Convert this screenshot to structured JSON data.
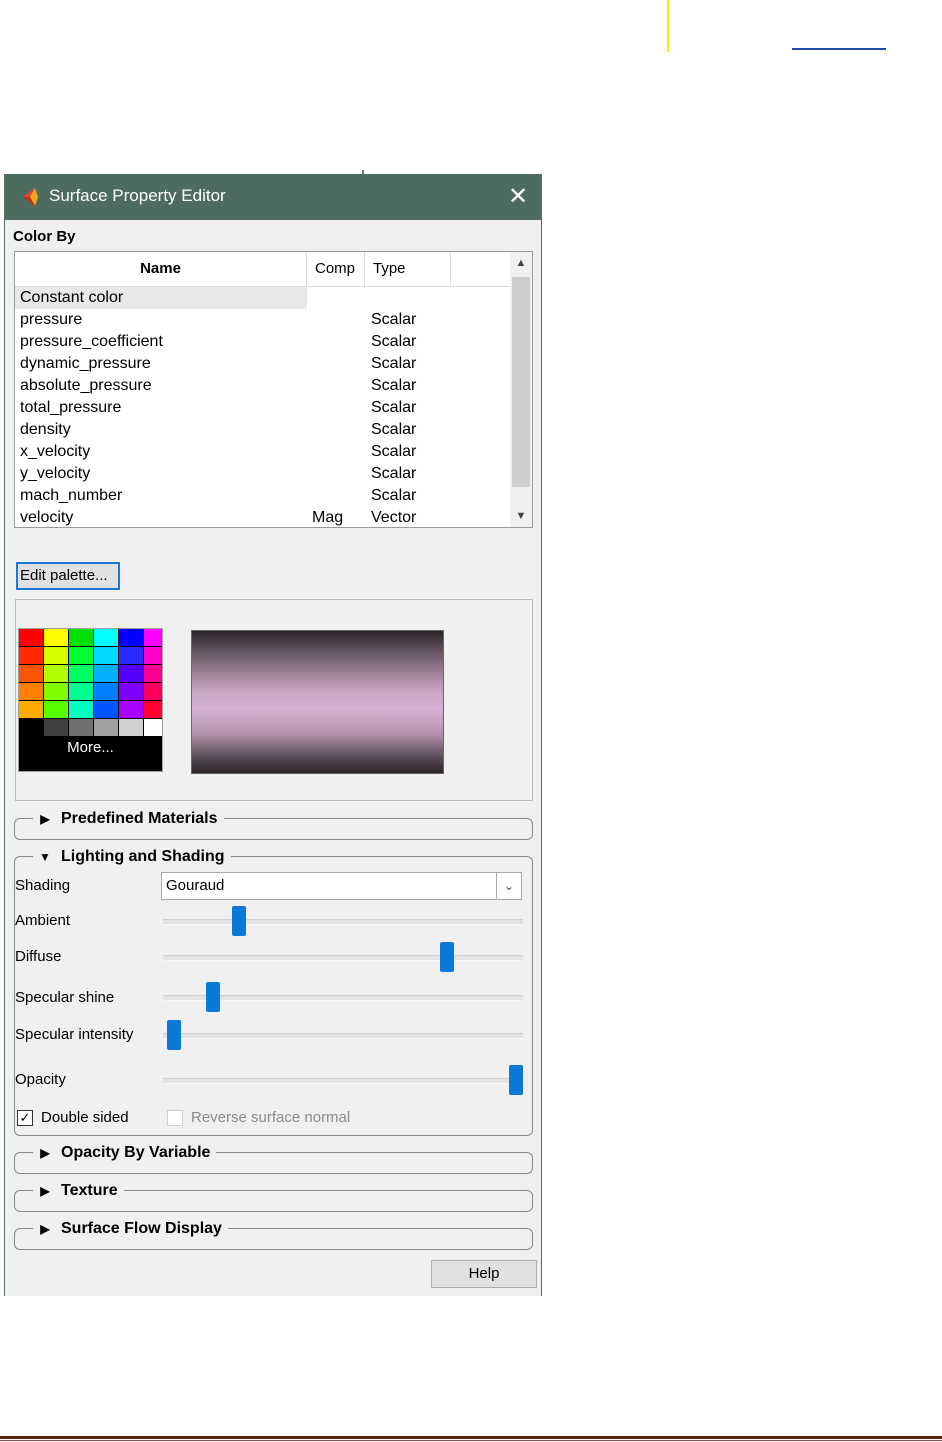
{
  "window": {
    "title": "Surface Property Editor",
    "close_label": "✕"
  },
  "color_by": {
    "label": "Color By",
    "columns": {
      "name": "Name",
      "comp": "Comp",
      "type": "Type"
    },
    "rows": [
      {
        "name": "Constant color",
        "comp": "",
        "type": ""
      },
      {
        "name": "pressure",
        "comp": "",
        "type": "Scalar"
      },
      {
        "name": "pressure_coefficient",
        "comp": "",
        "type": "Scalar"
      },
      {
        "name": "dynamic_pressure",
        "comp": "",
        "type": "Scalar"
      },
      {
        "name": "absolute_pressure",
        "comp": "",
        "type": "Scalar"
      },
      {
        "name": "total_pressure",
        "comp": "",
        "type": "Scalar"
      },
      {
        "name": "density",
        "comp": "",
        "type": "Scalar"
      },
      {
        "name": "x_velocity",
        "comp": "",
        "type": "Scalar"
      },
      {
        "name": "y_velocity",
        "comp": "",
        "type": "Scalar"
      },
      {
        "name": "mach_number",
        "comp": "",
        "type": "Scalar"
      },
      {
        "name": "velocity",
        "comp": "Mag",
        "type": "Vector"
      }
    ],
    "selected_row": "Constant color"
  },
  "palette": {
    "edit_label": "Edit palette...",
    "more_label": "More...",
    "swatch_rows": [
      [
        "#ff0000",
        "#ffff00",
        "#00e000",
        "#00ffff",
        "#0000ff",
        "#ff00ff"
      ],
      [
        "#ff2a00",
        "#d8ff00",
        "#00ff30",
        "#00d8ff",
        "#2a2aff",
        "#ff00c8"
      ],
      [
        "#ff5500",
        "#b0ff00",
        "#00ff60",
        "#00b0ff",
        "#5500ff",
        "#ff0090"
      ],
      [
        "#ff8000",
        "#80ff00",
        "#00ff90",
        "#0080ff",
        "#8000ff",
        "#ff0060"
      ],
      [
        "#ffaa00",
        "#55ff00",
        "#00ffc0",
        "#0055ff",
        "#aa00ff",
        "#ff0030"
      ],
      [
        "#000000",
        "#404040",
        "#707070",
        "#a0a0a0",
        "#d0d0d0",
        "#ffffff"
      ]
    ]
  },
  "groups": {
    "predefined_materials": "Predefined Materials",
    "lighting_and_shading": "Lighting and Shading",
    "opacity_by_variable": "Opacity By Variable",
    "texture": "Texture",
    "surface_flow_display": "Surface Flow Display"
  },
  "lighting": {
    "shading_label": "Shading",
    "shading_value": "Gouraud",
    "sliders": [
      {
        "label": "Ambient",
        "value": 0.21
      },
      {
        "label": "Diffuse",
        "value": 0.79
      },
      {
        "label": "Specular shine",
        "value": 0.14
      },
      {
        "label": "Specular intensity",
        "value": 0.03
      },
      {
        "label": "Opacity",
        "value": 0.98
      }
    ],
    "double_sided_label": "Double sided",
    "double_sided_checked": true,
    "reverse_normal_label": "Reverse surface normal",
    "reverse_normal_checked": false
  },
  "footer": {
    "help_label": "Help"
  },
  "colors": {
    "titlebar": "#4e6b5f",
    "accent": "#0a78d7"
  }
}
